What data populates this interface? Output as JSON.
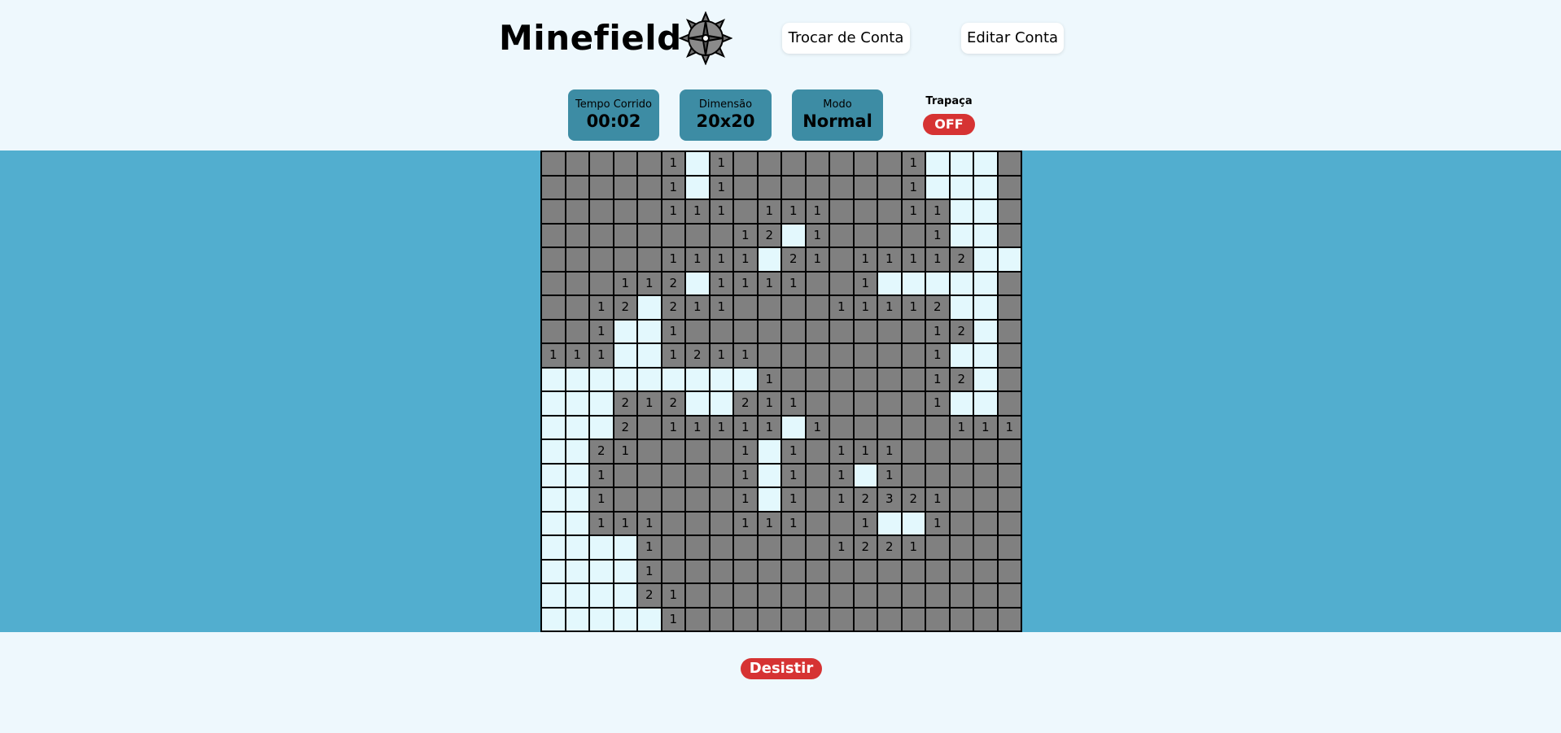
{
  "header": {
    "title": "Minefield",
    "logo_icon": "mine-icon",
    "switch_account_label": "Trocar de Conta",
    "edit_account_label": "Editar Conta"
  },
  "stats": {
    "elapsed_label": "Tempo Corrido",
    "elapsed_value": "00:02",
    "dimension_label": "Dimensão",
    "dimension_value": "20x20",
    "mode_label": "Modo",
    "mode_value": "Normal",
    "cheat_label": "Trapaça",
    "cheat_value": "OFF"
  },
  "colors": {
    "page_bg": "#eef8fd",
    "band_bg": "#52aecf",
    "stat_bg": "#3d8ca4",
    "hidden_cell": "#808080",
    "revealed_empty_cell": "#e3f8fd",
    "danger_button": "#d63333"
  },
  "board": {
    "rows": 20,
    "cols": 20,
    "legend": {
      "#": "hidden",
      ".": "revealed-empty",
      "1-8": "revealed-number"
    },
    "grid": [
      "#####1.1#######1...",
      "#####1.1#######1...",
      "#####111#111###11..",
      "########12.1####1..",
      "#####1111.21#11112..",
      "###112.1111##1.....",
      "##12.211####11112..",
      "##1..1##########12.",
      "111..1211#######1..",
      ".........1######12.",
      "...212..211#####1..",
      "...2#11111.1#####111",
      "..21####1.1#111####",
      "..1#####1.1#1.1####",
      "..1#####1.1#12321##",
      "..111###111##1..1##",
      "....1#######1221###",
      "....1###############",
      "....21##############",
      ".....1##############"
    ]
  },
  "footer": {
    "give_up_label": "Desistir"
  }
}
